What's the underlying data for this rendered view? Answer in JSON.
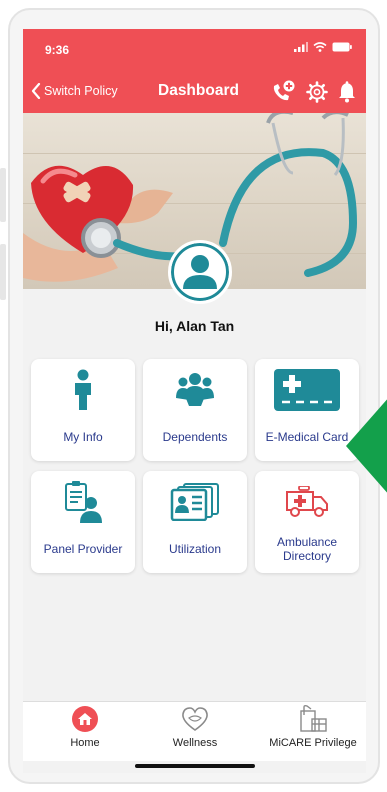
{
  "status": {
    "time": "9:36"
  },
  "nav": {
    "back_label": "Switch Policy",
    "title": "Dashboard"
  },
  "greeting": "Hi, Alan Tan",
  "menu": [
    {
      "label": "My Info",
      "icon": "person-icon"
    },
    {
      "label": "Dependents",
      "icon": "group-icon"
    },
    {
      "label": "E-Medical Card",
      "icon": "medical-card-icon"
    },
    {
      "label": "Panel Provider",
      "icon": "panel-provider-icon"
    },
    {
      "label": "Utilization",
      "icon": "utilization-icon"
    },
    {
      "label": "Ambulance Directory",
      "icon": "ambulance-icon"
    }
  ],
  "tabs": [
    {
      "label": "Home",
      "icon": "home-icon"
    },
    {
      "label": "Wellness",
      "icon": "wellness-icon"
    },
    {
      "label": "MiCARE Privilege",
      "icon": "gift-icon"
    }
  ],
  "colors": {
    "brand_red": "#ef4f55",
    "icon_teal": "#1f8a98",
    "label_blue": "#2a3a8c",
    "ambulance_red": "#e0474c",
    "arrow_green": "#13a04b"
  }
}
